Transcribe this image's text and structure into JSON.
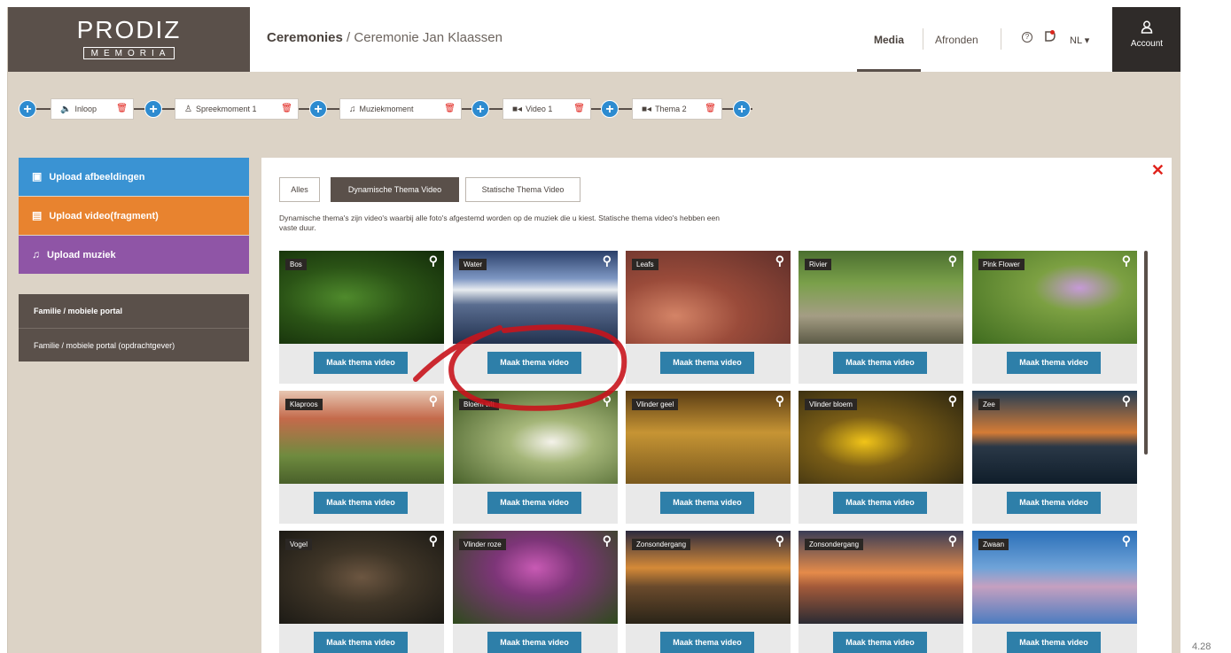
{
  "header": {
    "logo_line1": "PRODIZ",
    "logo_line2": "MEMORIA",
    "breadcrumb_root": "Ceremonies",
    "breadcrumb_sep": "/",
    "breadcrumb_current": "Ceremonie Jan Klaassen",
    "nav_media": "Media",
    "nav_afronden": "Afronden",
    "help_glyph": "?",
    "lang": "NL ▾",
    "account_label": "Account"
  },
  "timeline": [
    {
      "label": "Inloop",
      "icon": "sound-icon"
    },
    {
      "label": "Spreekmoment 1",
      "icon": "speaker-person-icon"
    },
    {
      "label": "Muziekmoment",
      "icon": "music-note-icon"
    },
    {
      "label": "Video 1",
      "icon": "video-camera-icon"
    },
    {
      "label": "Thema 2",
      "icon": "video-camera-icon"
    }
  ],
  "sidebar": {
    "upload_images": "Upload afbeeldingen",
    "upload_video": "Upload video(fragment)",
    "upload_music": "Upload muziek",
    "portal": "Familie / mobiele portal",
    "portal_client": "Familie / mobiele portal (opdrachtgever)"
  },
  "tabs": {
    "all": "Alles",
    "dynamic": "Dynamische Thema Video",
    "static": "Statische Thema Video",
    "active": "dynamic"
  },
  "description": "Dynamische thema's zijn video's waarbij alle foto's afgestemd worden op de muziek die u kiest. Statische thema video's hebben een vaste duur.",
  "make_button": "Maak thema video",
  "themes": [
    "Bos",
    "Water",
    "Leafs",
    "Rivier",
    "Pink Flower",
    "Klaproos",
    "Bloem wit",
    "Vlinder geel",
    "Vlinder bloem",
    "Zee",
    "Vogel",
    "Vlinder roze",
    "Zonsondergang",
    "Zonsondergang",
    "Zwaan"
  ],
  "colors": {
    "brand_dark": "#5a504a",
    "upload_images": "#3a93d3",
    "upload_video": "#e8832f",
    "upload_music": "#8f55a6",
    "make_button": "#2e7fa9",
    "delete_red": "#e0221b"
  },
  "page_number": "4.28"
}
